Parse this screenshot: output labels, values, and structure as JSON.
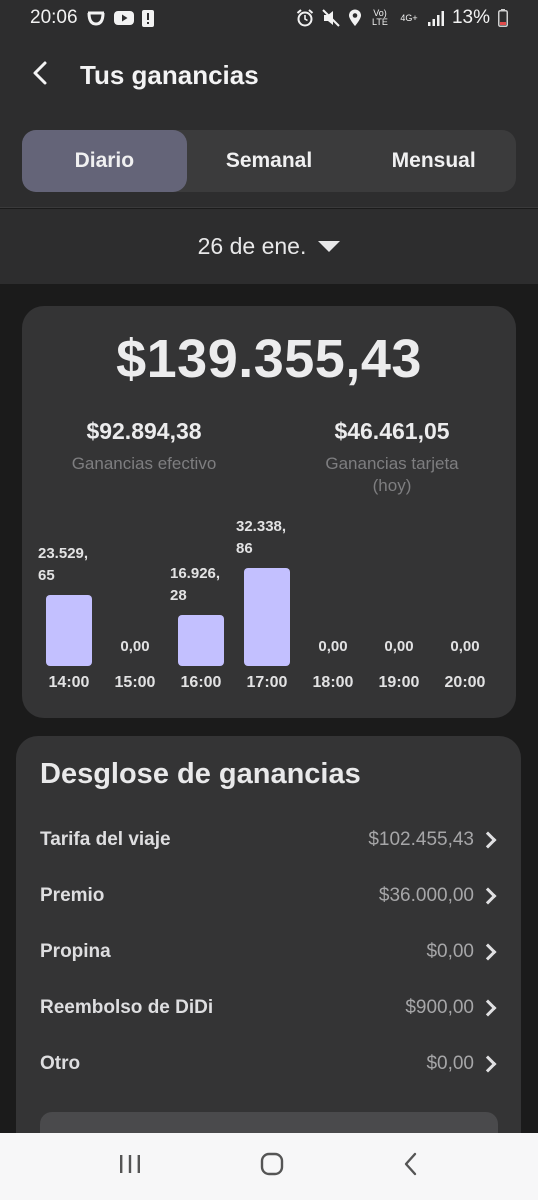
{
  "status_bar": {
    "time": "20:06",
    "battery": "13%",
    "volte": "Vo) LTE",
    "network": "4G+",
    "icons": [
      "didi-icon",
      "youtube-icon",
      "alert-icon",
      "alarm-icon",
      "mute-icon",
      "location-icon",
      "signal-icon",
      "battery-icon"
    ]
  },
  "header": {
    "title": "Tus ganancias"
  },
  "tabs": [
    {
      "label": "Diario",
      "active": true
    },
    {
      "label": "Semanal",
      "active": false
    },
    {
      "label": "Mensual",
      "active": false
    }
  ],
  "date": {
    "label": "26 de ene."
  },
  "summary": {
    "total": "$139.355,43",
    "cash_value": "$92.894,38",
    "cash_label": "Ganancias efectivo",
    "card_value": "$46.461,05",
    "card_label": "Ganancias tarjeta (hoy)"
  },
  "chart_data": {
    "type": "bar",
    "categories": [
      "14:00",
      "15:00",
      "16:00",
      "17:00",
      "18:00",
      "19:00",
      "20:00"
    ],
    "values": [
      23529.65,
      0,
      16926.28,
      32338.86,
      0,
      0,
      0
    ],
    "value_labels": [
      "23.529,\n65",
      "0,00",
      "16.926,\n28",
      "32.338,\n86",
      "0,00",
      "0,00",
      "0,00"
    ],
    "title": "",
    "xlabel": "",
    "ylabel": "",
    "ylim": [
      0,
      32338.86
    ],
    "grid": false,
    "bar_color": "#c3c0ff"
  },
  "breakdown": {
    "title": "Desglose de ganancias",
    "rows": [
      {
        "label": "Tarifa del viaje",
        "value": "$102.455,43"
      },
      {
        "label": "Premio",
        "value": "$36.000,00"
      },
      {
        "label": "Propina",
        "value": "$0,00"
      },
      {
        "label": "Reembolso de DiDi",
        "value": "$900,00"
      },
      {
        "label": "Otro",
        "value": "$0,00"
      }
    ]
  },
  "nav": {
    "icons": [
      "recents-icon",
      "home-icon",
      "back-nav-icon"
    ]
  },
  "colors": {
    "accent": "#c3c0ff",
    "active_tab": "#646478",
    "card": "#343435"
  }
}
